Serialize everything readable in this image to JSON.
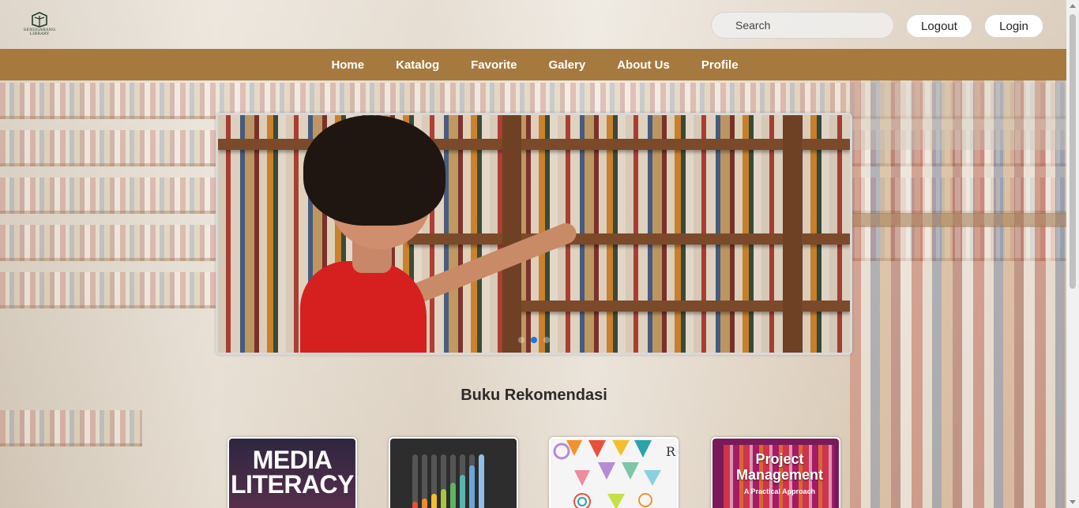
{
  "header": {
    "logo_line1": "SENGGARANG",
    "logo_line2": "LIBRARY",
    "search_placeholder": "Search",
    "logout_label": "Logout",
    "login_label": "Login"
  },
  "nav": {
    "items": [
      "Home",
      "Katalog",
      "Favorite",
      "Galery",
      "About Us",
      "Profile"
    ]
  },
  "carousel": {
    "slide_count": 3,
    "active_index": 1
  },
  "section": {
    "title": "Buku Rekomendasi"
  },
  "books": [
    {
      "cover_text": "MEDIA LITERACY"
    },
    {
      "cover_text": ""
    },
    {
      "cover_text": ""
    },
    {
      "cover_title": "Project Management",
      "cover_subtitle": "A Practical Approach"
    }
  ],
  "colors": {
    "navbar": "#a67a3f",
    "accent_dot": "#1e73e8"
  }
}
